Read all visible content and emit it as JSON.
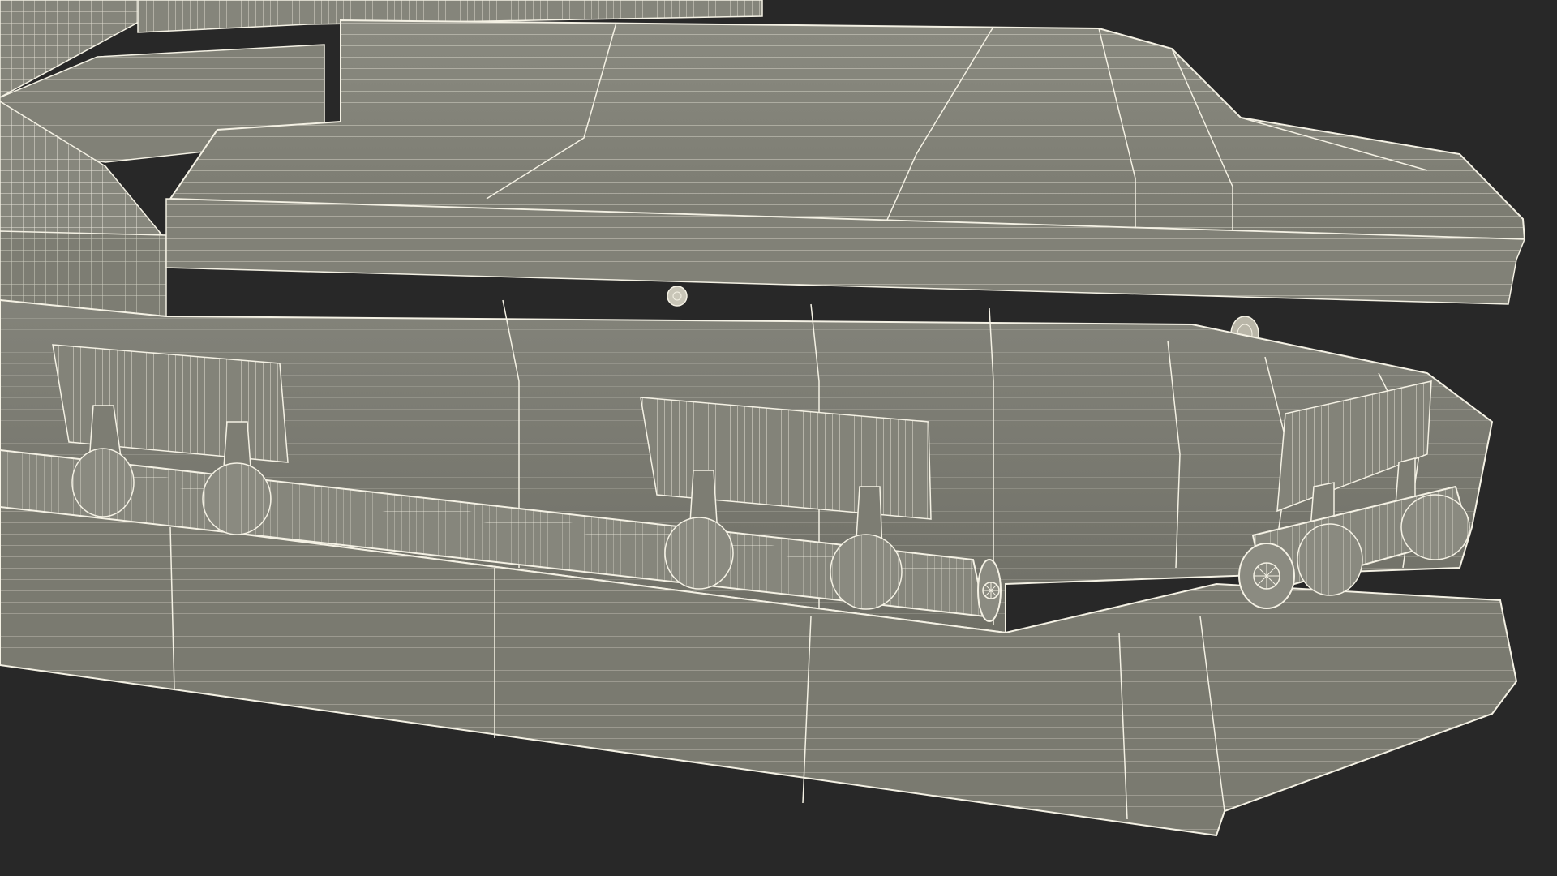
{
  "scene": {
    "subject": "casket-wireframe-render",
    "background_color": "#282828",
    "surface_color": "#7e7e72",
    "surface_shadow_color": "#6c6c62",
    "wire_color": "#f4f1e4"
  }
}
